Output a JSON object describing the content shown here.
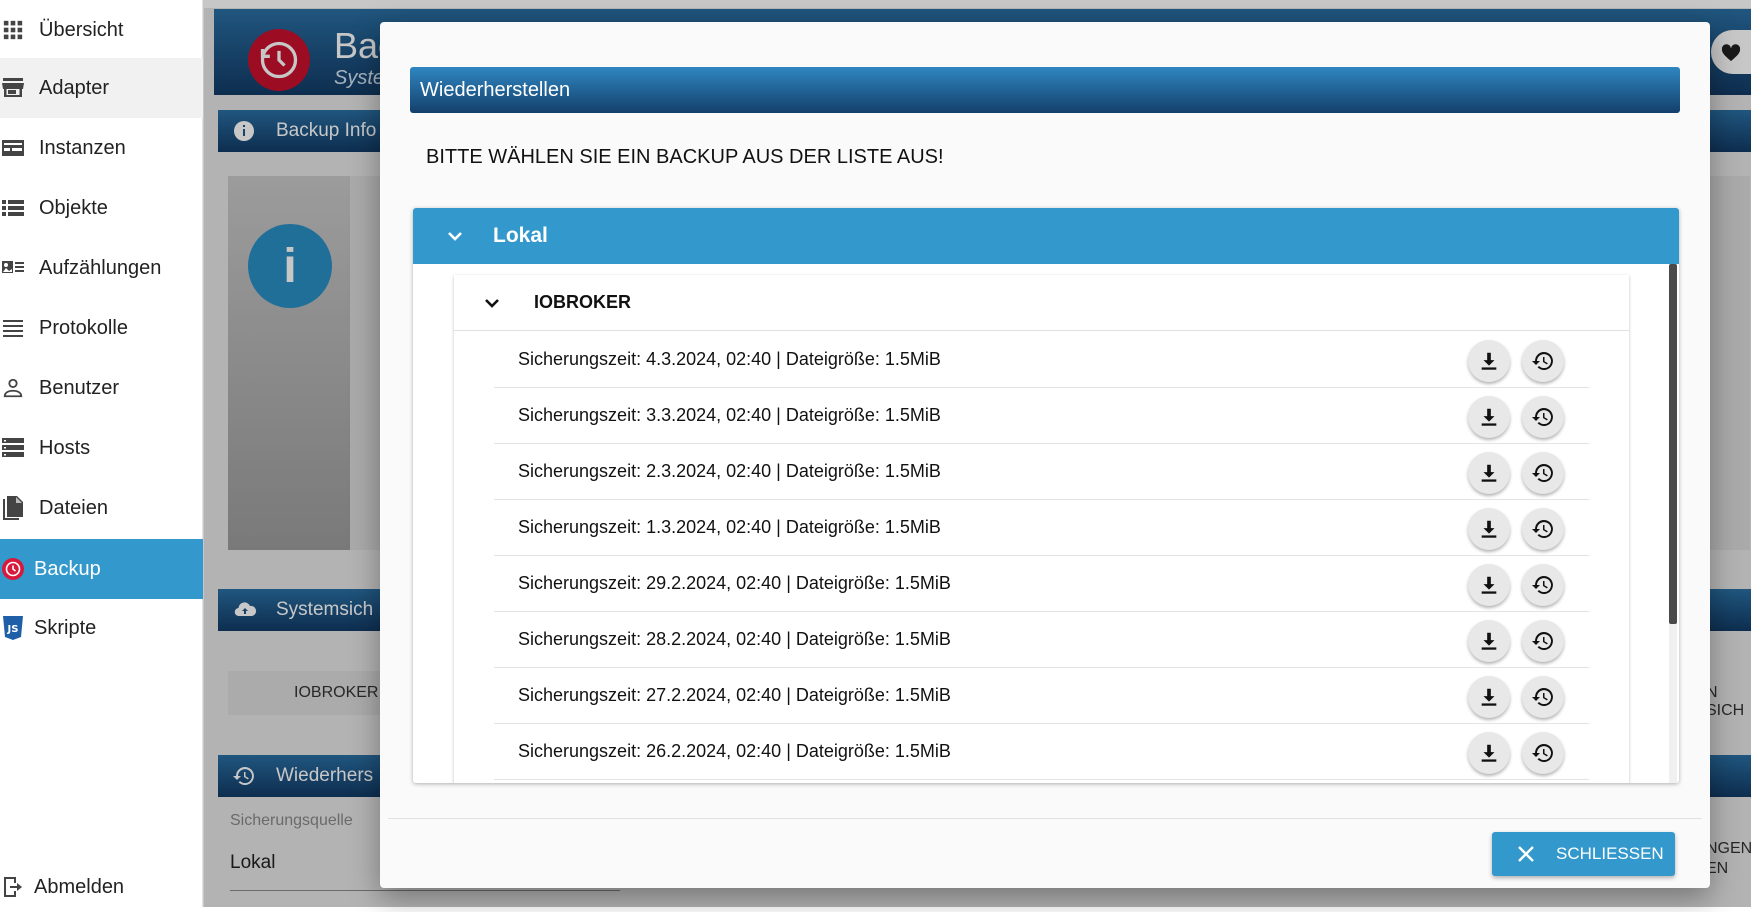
{
  "sidebar": {
    "items": [
      {
        "label": "Übersicht",
        "icon": "grid-icon"
      },
      {
        "label": "Adapter",
        "icon": "store-icon"
      },
      {
        "label": "Instanzen",
        "icon": "instances-icon"
      },
      {
        "label": "Objekte",
        "icon": "list-icon"
      },
      {
        "label": "Aufzählungen",
        "icon": "enum-icon"
      },
      {
        "label": "Protokolle",
        "icon": "log-icon"
      },
      {
        "label": "Benutzer",
        "icon": "user-icon"
      },
      {
        "label": "Hosts",
        "icon": "hosts-icon"
      },
      {
        "label": "Dateien",
        "icon": "files-icon"
      },
      {
        "label": "Backup",
        "icon": "backup-icon"
      },
      {
        "label": "Skripte",
        "icon": "js-icon"
      }
    ],
    "logout": "Abmelden",
    "active_color": "#3399cc"
  },
  "background": {
    "header_title": "Bac",
    "header_sub": "Syster",
    "panel_backup_info": "Backup Info",
    "panel_system": "Systemsich",
    "iobroker_button": "IOBROKER B",
    "panel_restore": "Wiederhers",
    "source_label": "Sicherungsquelle",
    "source_value": "Lokal",
    "right_text_1": "N SICH",
    "right_text_2": "NGEN",
    "right_text_3": "EN"
  },
  "modal": {
    "title": "Wiederherstellen",
    "instruction": "BITTE WÄHLEN SIE EIN BACKUP AUS DER LISTE AUS!",
    "accordion_label": "Lokal",
    "sub_label": "IOBROKER",
    "backups": [
      "Sicherungszeit: 4.3.2024, 02:40 | Dateigröße: 1.5MiB",
      "Sicherungszeit: 3.3.2024, 02:40 | Dateigröße: 1.5MiB",
      "Sicherungszeit: 2.3.2024, 02:40 | Dateigröße: 1.5MiB",
      "Sicherungszeit: 1.3.2024, 02:40 | Dateigröße: 1.5MiB",
      "Sicherungszeit: 29.2.2024, 02:40 | Dateigröße: 1.5MiB",
      "Sicherungszeit: 28.2.2024, 02:40 | Dateigröße: 1.5MiB",
      "Sicherungszeit: 27.2.2024, 02:40 | Dateigröße: 1.5MiB",
      "Sicherungszeit: 26.2.2024, 02:40 | Dateigröße: 1.5MiB"
    ],
    "close_label": "SCHLIESSEN",
    "accent": "#3399cc"
  }
}
